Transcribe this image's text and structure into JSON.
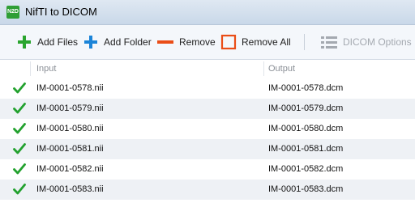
{
  "window": {
    "title": "NifTI to DICOM",
    "app_icon_text": "N2D"
  },
  "toolbar": {
    "add_files": "Add Files",
    "add_folder": "Add Folder",
    "remove": "Remove",
    "remove_all": "Remove All",
    "dicom_options": "DICOM Options"
  },
  "list": {
    "columns": {
      "input": "Input",
      "output": "Output"
    },
    "rows": [
      {
        "input": "IM-0001-0578.nii",
        "output": "IM-0001-0578.dcm"
      },
      {
        "input": "IM-0001-0579.nii",
        "output": "IM-0001-0579.dcm"
      },
      {
        "input": "IM-0001-0580.nii",
        "output": "IM-0001-0580.dcm"
      },
      {
        "input": "IM-0001-0581.nii",
        "output": "IM-0001-0581.dcm"
      },
      {
        "input": "IM-0001-0582.nii",
        "output": "IM-0001-0582.dcm"
      },
      {
        "input": "IM-0001-0583.nii",
        "output": "IM-0001-0583.dcm"
      }
    ]
  },
  "colors": {
    "check": "#22a12e",
    "add_plus_green": "#2aa52f",
    "add_plus_blue": "#1b84d8",
    "remove": "#ea4d17",
    "remove_all": "#ea4d17",
    "disabled": "#a4a9b0"
  }
}
